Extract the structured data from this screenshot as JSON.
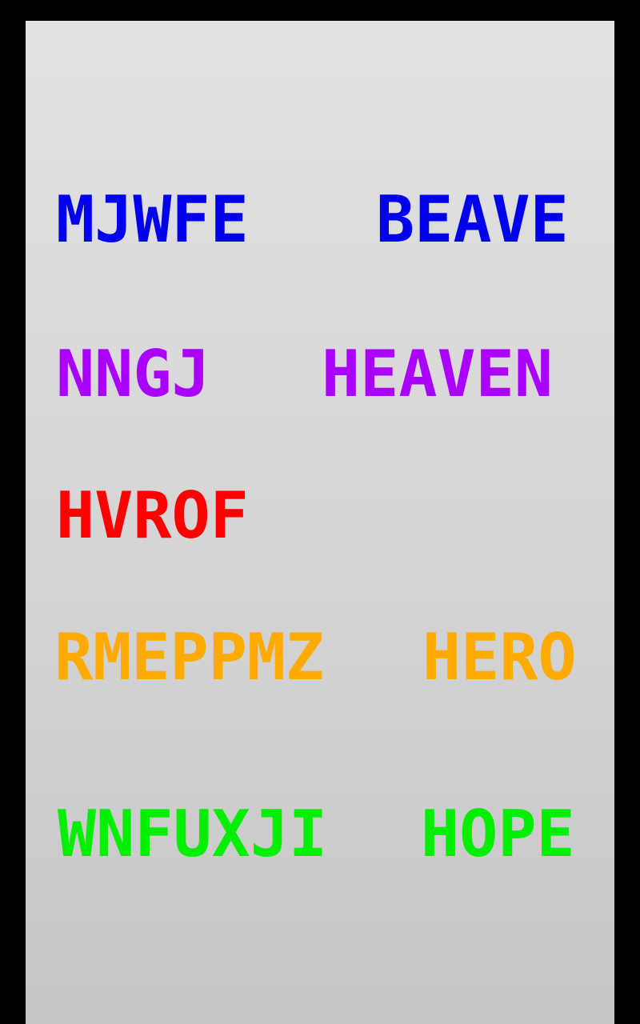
{
  "rows": [
    {
      "color": "#0000ee",
      "left_word": "MJWFE",
      "right_word": "BEAVE"
    },
    {
      "color": "#aa00ff",
      "left_word": "NNGJ",
      "right_word": "HEAVEN"
    },
    {
      "color": "#ff0000",
      "left_word": "HVROF",
      "right_word": ""
    },
    {
      "color": "#ffaa00",
      "left_word": "RMEPPMZ",
      "right_word": "HERO"
    },
    {
      "color": "#00ee00",
      "left_word": "WNFUXJI",
      "right_word": "HOPE"
    }
  ]
}
